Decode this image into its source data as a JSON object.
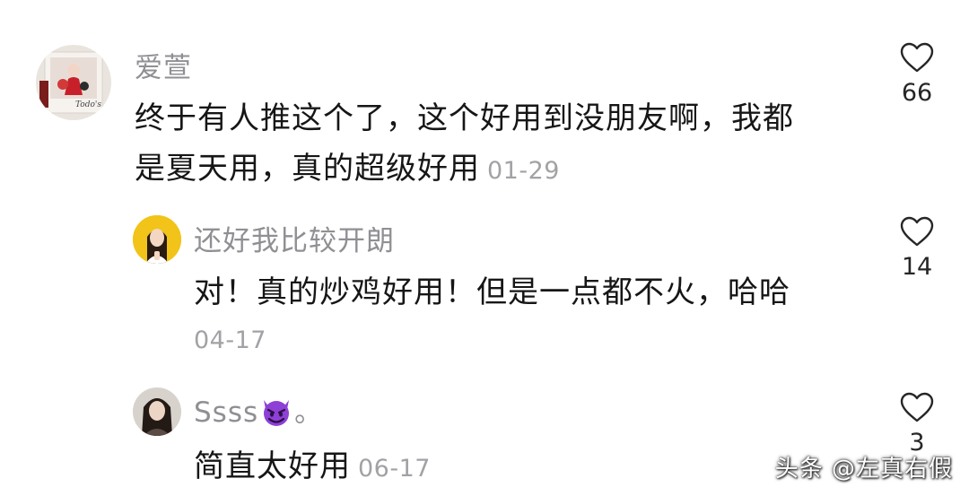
{
  "comments": [
    {
      "username": "爱萱",
      "text_line1": "终于有人推这个了，这个好用到没朋友啊，我都",
      "text_line2": "是夏天用，真的超级好用",
      "date": "01-29",
      "like_count": "66",
      "avatar_icon": "avatar-photo-icon",
      "avatar_caption": "Todo's"
    },
    {
      "username": "还好我比较开朗",
      "text_line1": "对！真的炒鸡好用！但是一点都不火，哈哈",
      "date": "04-17",
      "like_count": "14",
      "avatar_icon": "avatar-photo-icon"
    },
    {
      "username_prefix": "Ssss",
      "username_emoji": "smiling-devil-emoji",
      "username_suffix": "。",
      "text_line1": "简直太好用",
      "date": "06-17",
      "like_count": "3",
      "avatar_icon": "avatar-photo-icon"
    }
  ],
  "like_icon": "heart-outline-icon",
  "watermark": "头条 @左真右假",
  "colors": {
    "username": "#8f8f94",
    "body_text": "#161616",
    "date": "#a2a2a6",
    "emoji_purple": "#8d3fd6"
  }
}
